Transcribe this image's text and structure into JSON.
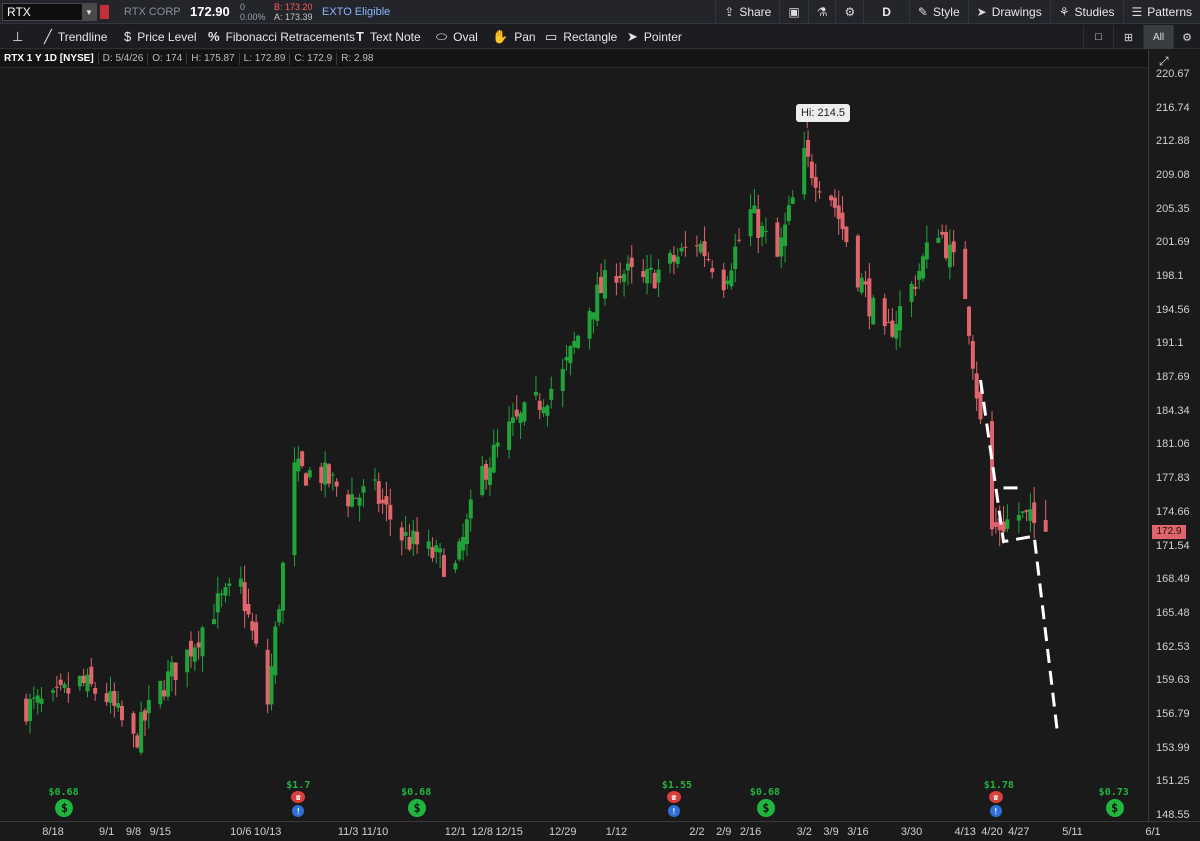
{
  "header": {
    "symbol": "RTX",
    "company": "RTX CORP",
    "last": "172.90",
    "change": "0",
    "change_pct": "0.00%",
    "bid": "B: 173.20",
    "ask": "A: 173.39",
    "exto": "EXTO Eligible",
    "buttons": {
      "share": "Share",
      "aggregation": "D",
      "style": "Style",
      "drawings": "Drawings",
      "studies": "Studies",
      "patterns": "Patterns"
    }
  },
  "toolbar": {
    "trendline": "Trendline",
    "price_level": "Price Level",
    "fib": "Fibonacci Retracements",
    "text_note": "Text Note",
    "oval": "Oval",
    "pan": "Pan",
    "rectangle": "Rectangle",
    "pointer": "Pointer",
    "all": "All"
  },
  "infoline": {
    "title": "RTX 1 Y 1D [NYSE]",
    "date": "D: 5/4/26",
    "open": "O: 174",
    "high": "H: 175.87",
    "low": "L: 172.89",
    "close": "C: 172.9",
    "range": "R: 2.98"
  },
  "colors": {
    "up": "#21a33a",
    "down": "#e0646c",
    "background": "#1a1a1a",
    "dividend": "#1fb63f",
    "earnings_red": "#d8403c",
    "earnings_blue": "#2f6fd6"
  },
  "price_axis": {
    "labels": [
      "220.67",
      "216.74",
      "212.88",
      "209.08",
      "205.35",
      "201.69",
      "198.1",
      "194.56",
      "191.1",
      "187.69",
      "184.34",
      "181.06",
      "177.83",
      "174.66",
      "171.54",
      "168.49",
      "165.48",
      "162.53",
      "159.63",
      "156.79",
      "153.99",
      "151.25",
      "148.55"
    ],
    "current": "172.9",
    "scale": "log"
  },
  "date_axis": [
    "8/18",
    "9/1",
    "9/8",
    "9/15",
    "10/6",
    "10/13",
    "11/3",
    "11/10",
    "12/1",
    "12/8",
    "12/15",
    "12/29",
    "1/12",
    "2/2",
    "2/9",
    "2/16",
    "3/2",
    "3/9",
    "3/16",
    "3/30",
    "4/13",
    "4/20",
    "4/27",
    "5/11",
    "6/1"
  ],
  "high_label": "Hi: 214.5",
  "dividends": [
    "$0.68",
    "$0.68",
    "$0.68",
    "$0.73"
  ],
  "earnings": [
    "$1.7",
    "$1.55",
    "$1.78"
  ],
  "chart_data": {
    "type": "candlestick",
    "title": "RTX 1 Y 1D [NYSE]",
    "y_range": [
      148.55,
      220.67
    ],
    "y_scale": "log",
    "x_range": [
      "2025-08-11",
      "2026-06-01"
    ],
    "high": 214.5,
    "last": 172.9,
    "closes_approx": [
      {
        "date": "2025-08-11",
        "close": 157.5
      },
      {
        "date": "2025-08-18",
        "close": 157.8
      },
      {
        "date": "2025-08-25",
        "close": 159.5
      },
      {
        "date": "2025-09-01",
        "close": 158.3
      },
      {
        "date": "2025-09-08",
        "close": 154.5
      },
      {
        "date": "2025-09-15",
        "close": 159.0
      },
      {
        "date": "2025-09-22",
        "close": 162.0
      },
      {
        "date": "2025-09-29",
        "close": 166.0
      },
      {
        "date": "2025-10-06",
        "close": 168.0
      },
      {
        "date": "2025-10-13",
        "close": 157.8
      },
      {
        "date": "2025-10-20",
        "close": 178.5
      },
      {
        "date": "2025-10-27",
        "close": 178.3
      },
      {
        "date": "2025-11-03",
        "close": 176.2
      },
      {
        "date": "2025-11-10",
        "close": 176.5
      },
      {
        "date": "2025-11-17",
        "close": 172.5
      },
      {
        "date": "2025-11-24",
        "close": 171.0
      },
      {
        "date": "2025-12-01",
        "close": 169.5
      },
      {
        "date": "2025-12-08",
        "close": 178.5
      },
      {
        "date": "2025-12-15",
        "close": 182.5
      },
      {
        "date": "2025-12-22",
        "close": 185.0
      },
      {
        "date": "2025-12-29",
        "close": 188.0
      },
      {
        "date": "2026-01-05",
        "close": 195.0
      },
      {
        "date": "2026-01-12",
        "close": 199.0
      },
      {
        "date": "2026-01-19",
        "close": 197.5
      },
      {
        "date": "2026-01-26",
        "close": 199.5
      },
      {
        "date": "2026-02-02",
        "close": 202.0
      },
      {
        "date": "2026-02-09",
        "close": 198.0
      },
      {
        "date": "2026-02-16",
        "close": 205.0
      },
      {
        "date": "2026-02-23",
        "close": 200.0
      },
      {
        "date": "2026-03-02",
        "close": 211.0
      },
      {
        "date": "2026-03-09",
        "close": 207.0
      },
      {
        "date": "2026-03-16",
        "close": 198.5
      },
      {
        "date": "2026-03-23",
        "close": 191.5
      },
      {
        "date": "2026-03-30",
        "close": 197.0
      },
      {
        "date": "2026-04-06",
        "close": 203.5
      },
      {
        "date": "2026-04-13",
        "close": 196.5
      },
      {
        "date": "2026-04-20",
        "close": 173.0
      },
      {
        "date": "2026-04-27",
        "close": 174.5
      },
      {
        "date": "2026-05-04",
        "close": 172.9
      }
    ],
    "annotations": {
      "projection_line": [
        {
          "date": "2026-04-17",
          "price": 187.5
        },
        {
          "date": "2026-04-23",
          "price": 172.0
        },
        {
          "date": "2026-05-01",
          "price": 172.5
        },
        {
          "date": "2026-05-07",
          "price": 155.5
        }
      ],
      "flag_top": [
        {
          "date": "2026-04-23",
          "price": 177.0
        },
        {
          "date": "2026-04-27",
          "price": 177.0
        }
      ]
    }
  }
}
